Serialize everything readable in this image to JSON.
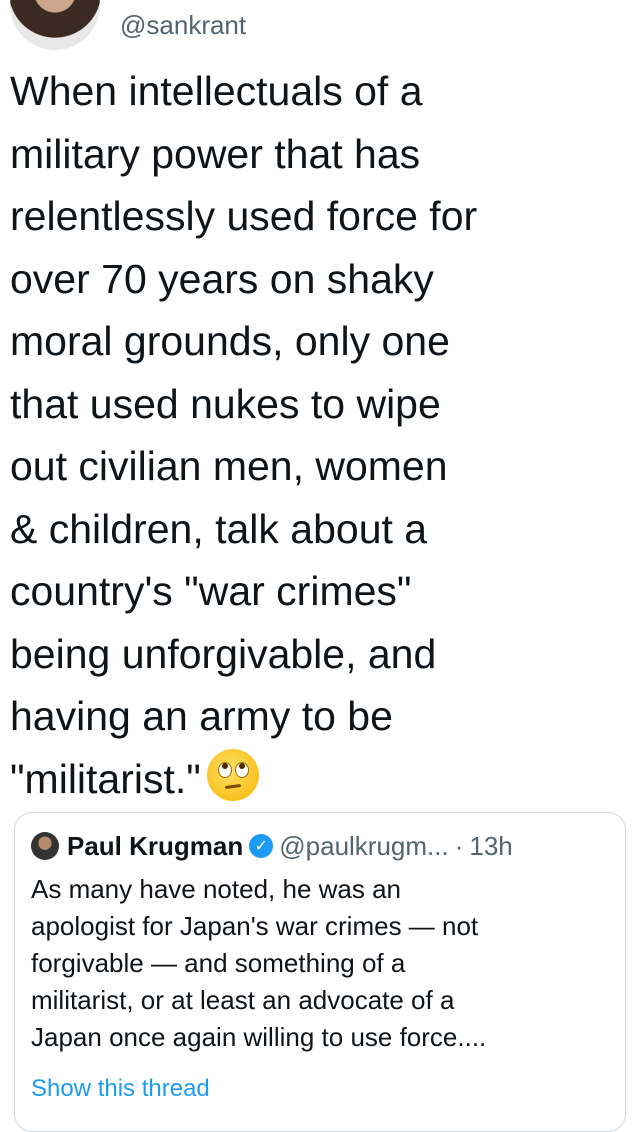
{
  "tweet": {
    "handle": "@sankrant",
    "lines": [
      "When intellectuals of a",
      "military power that has",
      "relentlessly used force for",
      "over 70 years on shaky",
      "moral grounds, only one",
      "that used nukes to wipe",
      "out civilian men, women",
      "& children, talk about a",
      "country's \"war crimes\"",
      "being unforgivable, and",
      "having an army to be",
      "\"militarist.\""
    ],
    "emoji_icon": "face-with-rolling-eyes-icon"
  },
  "quoted": {
    "name": "Paul Krugman",
    "handle": "@paulkrugm...",
    "separator": "·",
    "time": "13h",
    "lines": [
      "As many have noted, he was an",
      "apologist for Japan's war crimes — not",
      "forgivable — and something of a",
      "militarist, or at least an advocate of a",
      "Japan once again willing to use force...."
    ],
    "show_thread": "Show this thread"
  },
  "colors": {
    "text": "#0f1419",
    "secondary": "#536471",
    "verified": "#1d9bf0",
    "border": "#cfd9de"
  }
}
